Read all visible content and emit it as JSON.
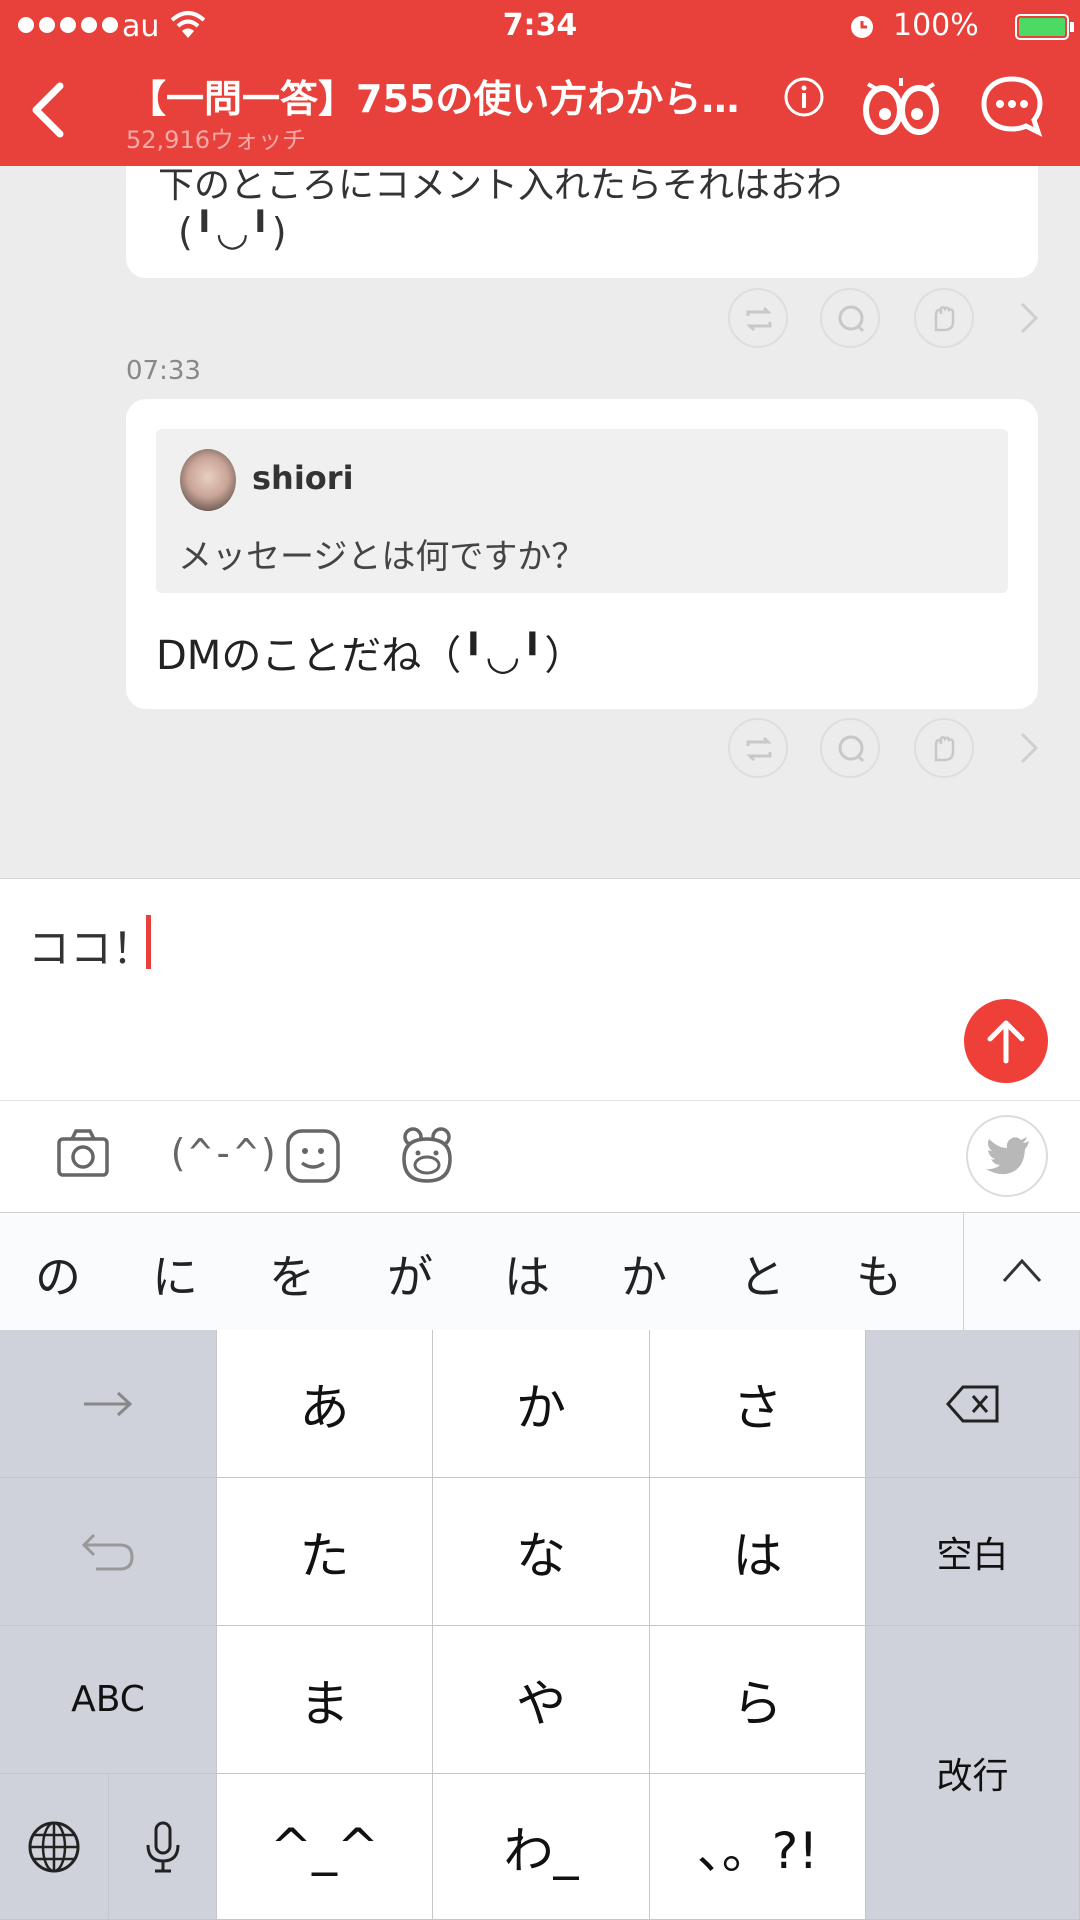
{
  "status_bar": {
    "carrier": "au",
    "time": "7:34",
    "battery": "100%"
  },
  "nav": {
    "title": "【一問一答】755の使い方わから…",
    "subtitle": "52,916ウォッチ"
  },
  "messages": [
    {
      "line1": "下のところにコメント入れたらそれはおわ",
      "line2": "(╹◡╹)"
    },
    {
      "timestamp": "07:33",
      "quote_user": "shiori",
      "quote_text": "メッセージとは何ですか？",
      "reply": "DMのことだね（╹◡╹）"
    }
  ],
  "input": {
    "value": "ココ！"
  },
  "toolbar": {
    "kaomoji": "(^-^)"
  },
  "keyboard": {
    "suggestions": [
      "の",
      "に",
      "を",
      "が",
      "は",
      "か",
      "と",
      "も"
    ],
    "keys": {
      "a": "あ",
      "ka": "か",
      "sa": "さ",
      "ta": "た",
      "na": "な",
      "ha": "は",
      "ma": "ま",
      "ya": "や",
      "ra": "ら",
      "emoticon": "^_^",
      "wa": "わ_",
      "punct": "、。?!",
      "space": "空白",
      "abc": "ABC",
      "return": "改行"
    }
  },
  "colors": {
    "accent": "#e8403a",
    "background": "#ececec"
  }
}
